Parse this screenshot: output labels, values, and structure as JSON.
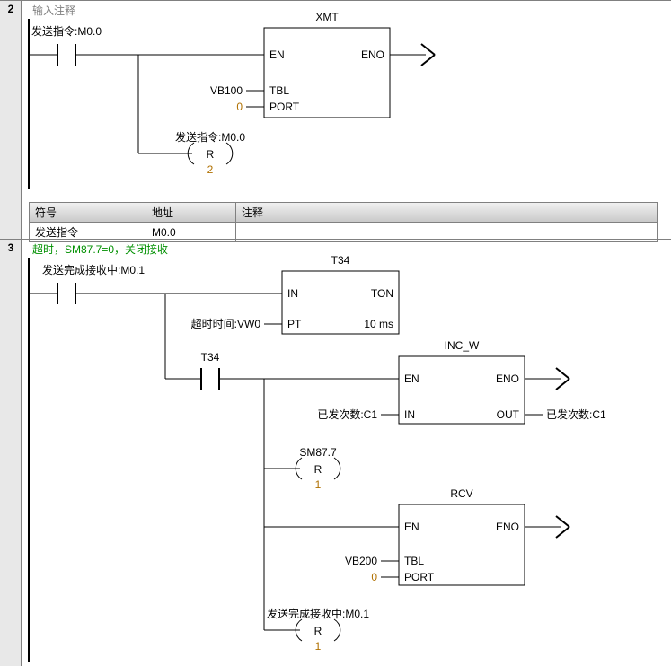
{
  "network2": {
    "num": "2",
    "title": "输入注释",
    "contact1_label": "发送指令:M0.0",
    "block": {
      "name": "XMT",
      "en": "EN",
      "eno": "ENO",
      "tbl_pin": "TBL",
      "tbl_val": "VB100",
      "port_pin": "PORT",
      "port_val": "0"
    },
    "reset": {
      "label": "发送指令:M0.0",
      "op": "R",
      "count": "2"
    },
    "table": {
      "h_sym": "符号",
      "h_addr": "地址",
      "h_comment": "注释",
      "r1_sym": "发送指令",
      "r1_addr": "M0.0",
      "r1_comment": ""
    }
  },
  "network3": {
    "num": "3",
    "title": "超时，SM87.7=0，关闭接收",
    "contact1_label": "发送完成接收中:M0.1",
    "timer": {
      "name": "T34",
      "in": "IN",
      "type": "TON",
      "pt": "PT",
      "pt_val": "超时时间:VW0",
      "time": "10 ms"
    },
    "t34_contact": "T34",
    "incw": {
      "name": "INC_W",
      "en": "EN",
      "eno": "ENO",
      "in_pin": "IN",
      "in_val": "已发次数:C1",
      "out_pin": "OUT",
      "out_val": "已发次数:C1"
    },
    "reset1": {
      "label": "SM87.7",
      "op": "R",
      "count": "1"
    },
    "rcv": {
      "name": "RCV",
      "en": "EN",
      "eno": "ENO",
      "tbl_pin": "TBL",
      "tbl_val": "VB200",
      "port_pin": "PORT",
      "port_val": "0"
    },
    "reset2": {
      "label": "发送完成接收中:M0.1",
      "op": "R",
      "count": "1"
    }
  }
}
